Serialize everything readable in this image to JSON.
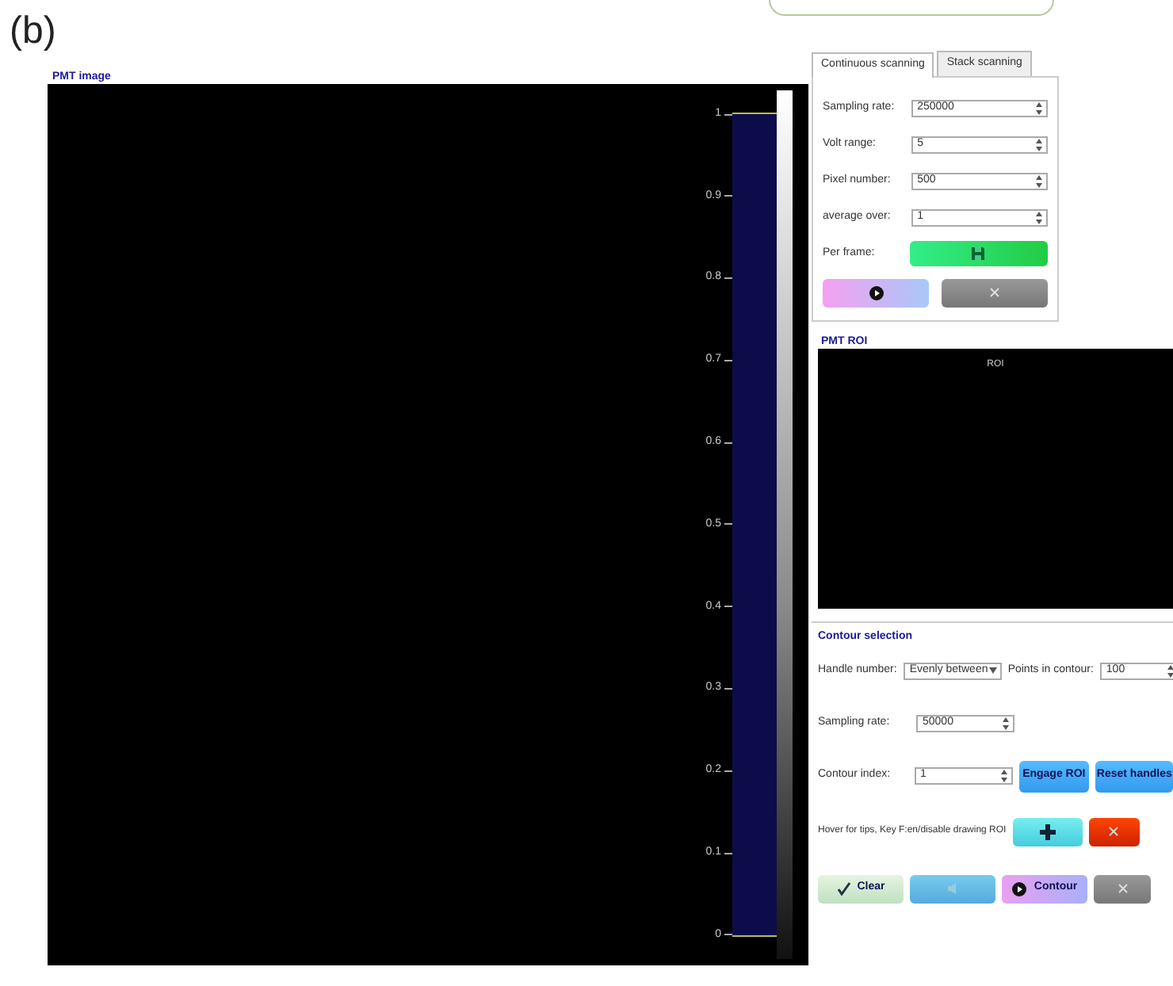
{
  "figure_label": "(b)",
  "pmt_image": {
    "title": "PMT image",
    "histogram_ticks": [
      "1",
      "0.9",
      "0.8",
      "0.7",
      "0.6",
      "0.5",
      "0.4",
      "0.3",
      "0.2",
      "0.1",
      "0"
    ]
  },
  "scan_tabs": [
    {
      "label": "Continuous scanning",
      "selected": true
    },
    {
      "label": "Stack scanning",
      "selected": false
    }
  ],
  "scan_fields": [
    {
      "label": "Sampling rate:",
      "value": "250000"
    },
    {
      "label": "Volt range:",
      "value": "5"
    },
    {
      "label": "Pixel number:",
      "value": "500"
    },
    {
      "label": "average over:",
      "value": "1"
    }
  ],
  "per_frame": {
    "label": "Per frame:"
  },
  "scan_buttons": [
    {
      "kind": "play"
    },
    {
      "kind": "stop"
    }
  ],
  "roi": {
    "title": "PMT ROI",
    "label": "ROI"
  },
  "contour": {
    "title": "Contour selection",
    "handle_label": "Handle number:",
    "handle_value": "Evenly between",
    "points_label": "Points in contour:",
    "points_value": "100",
    "sampling_label": "Sampling rate:",
    "sampling_value": "50000",
    "index_label": "Contour index:",
    "index_value": "1",
    "engage": "Engage ROI",
    "reset": "Reset handles",
    "hint": "Hover for tips, Key F:en/disable drawing ROI",
    "bottom_buttons": [
      {
        "kind": "clear",
        "label": "Clear"
      },
      {
        "kind": "speaker"
      },
      {
        "kind": "contour",
        "label": "Contour"
      },
      {
        "kind": "stop"
      }
    ]
  }
}
